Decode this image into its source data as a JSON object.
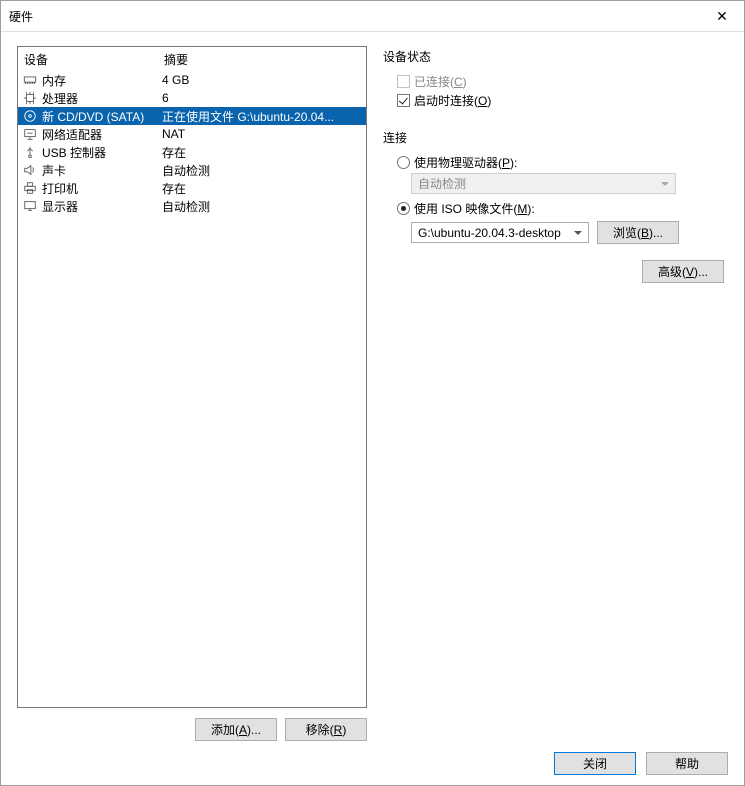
{
  "title": "硬件",
  "columns": {
    "device": "设备",
    "summary": "摘要"
  },
  "devices": [
    {
      "id": "memory",
      "icon": "memory-icon",
      "label": "内存",
      "summary": "4 GB"
    },
    {
      "id": "cpu",
      "icon": "cpu-icon",
      "label": "处理器",
      "summary": "6"
    },
    {
      "id": "cdrom",
      "icon": "disc-icon",
      "label": "新 CD/DVD (SATA)",
      "summary": "正在使用文件 G:\\ubuntu-20.04..."
    },
    {
      "id": "network",
      "icon": "network-icon",
      "label": "网络适配器",
      "summary": "NAT"
    },
    {
      "id": "usb",
      "icon": "usb-icon",
      "label": "USB 控制器",
      "summary": "存在"
    },
    {
      "id": "sound",
      "icon": "sound-icon",
      "label": "声卡",
      "summary": "自动检测"
    },
    {
      "id": "printer",
      "icon": "printer-icon",
      "label": "打印机",
      "summary": "存在"
    },
    {
      "id": "display",
      "icon": "display-icon",
      "label": "显示器",
      "summary": "自动检测"
    }
  ],
  "selected_device_id": "cdrom",
  "buttons": {
    "add": {
      "label": "添加(",
      "key": "A",
      "suffix": ")..."
    },
    "remove": {
      "label": "移除(",
      "key": "R",
      "suffix": ")"
    },
    "browse": {
      "label": "浏览(",
      "key": "B",
      "suffix": ")..."
    },
    "advanced": {
      "label": "高级(",
      "key": "V",
      "suffix": ")..."
    },
    "close": "关闭",
    "help": "帮助"
  },
  "device_status": {
    "title": "设备状态",
    "connected": {
      "label": "已连接(",
      "key": "C",
      "suffix": ")",
      "checked": false,
      "enabled": false
    },
    "connect_on_start": {
      "label": "启动时连接(",
      "key": "O",
      "suffix": ")",
      "checked": true,
      "enabled": true
    }
  },
  "connection": {
    "title": "连接",
    "physical": {
      "label": "使用物理驱动器(",
      "key": "P",
      "suffix": "):",
      "selected": false,
      "drive_value": "自动检测"
    },
    "iso": {
      "label": "使用 ISO 映像文件(",
      "key": "M",
      "suffix": "):",
      "selected": true,
      "path": "G:\\ubuntu-20.04.3-desktop"
    }
  }
}
